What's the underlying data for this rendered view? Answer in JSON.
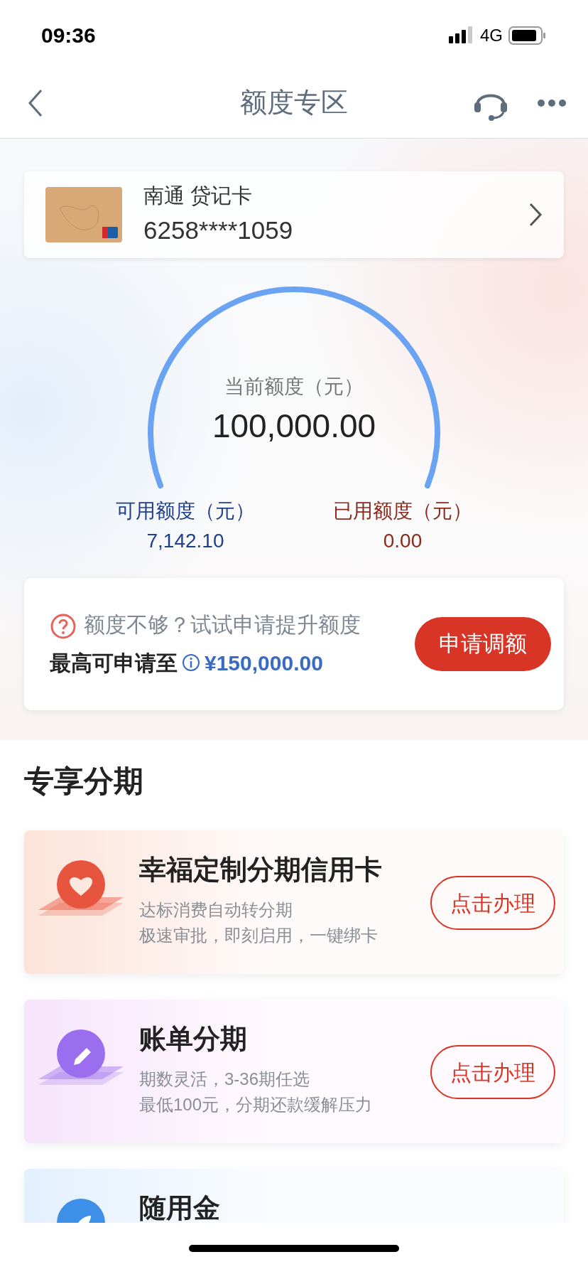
{
  "status_bar": {
    "time": "09:36",
    "network": "4G"
  },
  "nav": {
    "title": "额度专区"
  },
  "card": {
    "name": "南通 贷记卡",
    "number": "6258****1059"
  },
  "gauge": {
    "label": "当前额度（元）",
    "amount": "100,000.00"
  },
  "available": {
    "label": "可用额度（元）",
    "amount": "7,142.10"
  },
  "used": {
    "label": "已用额度（元）",
    "amount": "0.00"
  },
  "apply": {
    "prompt": "额度不够？试试申请提升额度",
    "max_label": "最高可申请至",
    "max_amount": "¥150,000.00",
    "button": "申请调额"
  },
  "section_title": "专享分期",
  "products": [
    {
      "kind": "heart",
      "color": "#e8553f",
      "title": "幸福定制分期信用卡",
      "lines": [
        "达标消费自动转分期",
        "极速审批，即刻启用，一键绑卡"
      ],
      "action": "点击办理"
    },
    {
      "kind": "pencil",
      "color": "#9b6ef0",
      "title": "账单分期",
      "lines": [
        "期数灵活，3-36期任选",
        "最低100元，分期还款缓解压力"
      ],
      "action": "点击办理"
    },
    {
      "kind": "rocket",
      "color": "#3d8fe8",
      "title": "随用金"
    }
  ]
}
